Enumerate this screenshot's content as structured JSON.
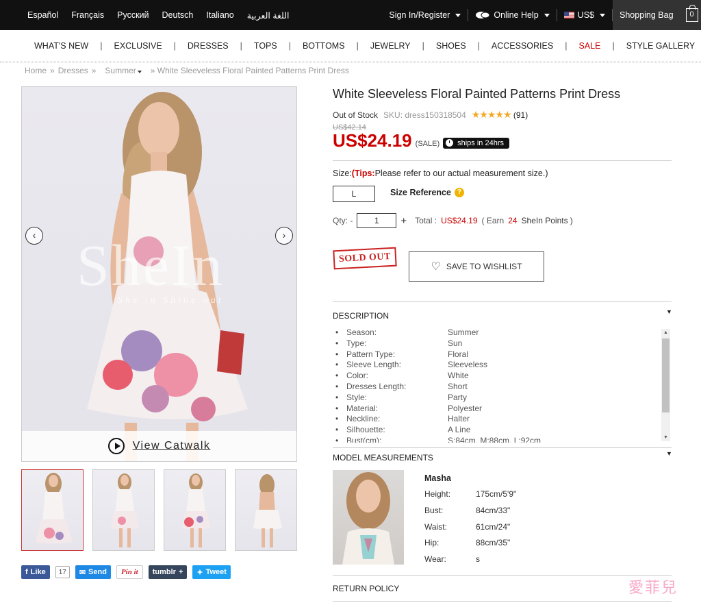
{
  "top_bar": {
    "languages": [
      "Español",
      "Français",
      "Русский",
      "Deutsch",
      "Italiano",
      "اللغة العربية"
    ],
    "sign_in": "Sign In/Register",
    "online_help": "Online Help",
    "currency": "US$",
    "shopping_bag": "Shopping Bag",
    "bag_count": "0"
  },
  "category_nav": [
    "WHAT'S NEW",
    "EXCLUSIVE",
    "DRESSES",
    "TOPS",
    "BOTTOMS",
    "JEWELRY",
    "SHOES",
    "ACCESSORIES",
    "SALE",
    "STYLE GALLERY"
  ],
  "breadcrumb": {
    "home": "Home",
    "dresses": "Dresses",
    "summer": "Summer",
    "current": "» White Sleeveless Floral Painted Patterns Print Dress",
    "sep": "»"
  },
  "gallery": {
    "watermark": "SheIn",
    "watermark_sub": "She in   Shine out",
    "view_catwalk": "View Catwalk",
    "prev": "‹",
    "next": "›"
  },
  "social": {
    "like": "Like",
    "like_count": "17",
    "send": "Send",
    "pin": "Pin it",
    "tumblr": "tumblr",
    "tweet": "Tweet"
  },
  "product": {
    "title": "White Sleeveless Floral Painted Patterns Print Dress",
    "stock": "Out of Stock",
    "sku": "SKU: dress150318504",
    "stars": "★★★★★",
    "rating_count": "(91)",
    "old_price": "US$42.14",
    "price": "US$24.19",
    "sale_tag": "(SALE)",
    "ships": "ships in 24hrs",
    "size_label": "Size:",
    "tips_label": "(Tips:",
    "tips_text": "Please refer to our actual measurement size.)",
    "selected_size": "L",
    "size_reference": "Size Reference",
    "qty_label": "Qty: -",
    "qty_value": "1",
    "total_label": "Total :",
    "total_value": "US$24.19",
    "earn_prefix": "( Earn",
    "earn_points": "24",
    "earn_suffix": "SheIn Points )",
    "sold_out": "SOLD OUT",
    "wishlist": "SAVE TO WISHLIST"
  },
  "description": {
    "heading": "DESCRIPTION",
    "rows": [
      {
        "k": "Season:",
        "v": "Summer"
      },
      {
        "k": "Type:",
        "v": "Sun"
      },
      {
        "k": "Pattern Type:",
        "v": "Floral"
      },
      {
        "k": "Sleeve Length:",
        "v": "Sleeveless"
      },
      {
        "k": "Color:",
        "v": "White"
      },
      {
        "k": "Dresses Length:",
        "v": "Short"
      },
      {
        "k": "Style:",
        "v": "Party"
      },
      {
        "k": "Material:",
        "v": "Polyester"
      },
      {
        "k": "Neckline:",
        "v": "Halter"
      },
      {
        "k": "Silhouette:",
        "v": "A Line"
      },
      {
        "k": "Bust(cm):",
        "v": "S:84cm, M:88cm, L:92cm"
      }
    ]
  },
  "model": {
    "heading": "MODEL MEASUREMENTS",
    "name": "Masha",
    "rows": [
      {
        "k": "Height:",
        "v": "175cm/5'9\""
      },
      {
        "k": "Bust:",
        "v": "84cm/33\""
      },
      {
        "k": "Waist:",
        "v": "61cm/24\""
      },
      {
        "k": "Hip:",
        "v": "88cm/35\""
      },
      {
        "k": "Wear:",
        "v": "s"
      }
    ]
  },
  "return_policy": "RETURN POLICY",
  "corner_mark": "愛菲兒"
}
